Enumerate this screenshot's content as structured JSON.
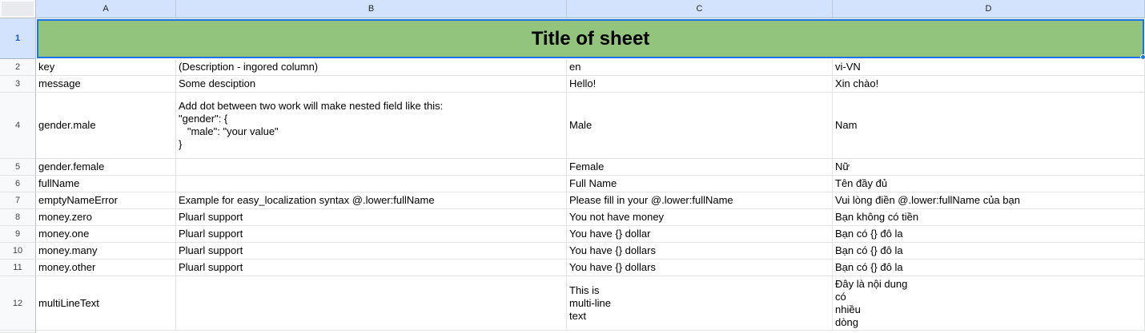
{
  "columns": [
    "A",
    "B",
    "C",
    "D"
  ],
  "title": "Title of sheet",
  "accent_color": "#1a73e8",
  "title_fill_color": "#93c47d",
  "rows": [
    {
      "num": "1"
    },
    {
      "num": "2",
      "cells": [
        "key",
        "(Description - ingored column)",
        "en",
        "vi-VN"
      ]
    },
    {
      "num": "3",
      "cells": [
        "message",
        "Some desciption",
        "Hello!",
        "Xin chào!"
      ]
    },
    {
      "num": "4",
      "cells": [
        "gender.male",
        "Add dot between two work will make nested field like this:\n\"gender\": {\n   \"male\": \"your value\"\n}",
        "Male",
        "Nam"
      ]
    },
    {
      "num": "5",
      "cells": [
        "gender.female",
        "",
        "Female",
        "Nữ"
      ]
    },
    {
      "num": "6",
      "cells": [
        "fullName",
        "",
        "Full Name",
        "Tên đầy đủ"
      ]
    },
    {
      "num": "7",
      "cells": [
        "emptyNameError",
        "Example for easy_localization syntax @.lower:fullName",
        "Please fill in your @.lower:fullName",
        "Vui lòng điền @.lower:fullName của bạn"
      ]
    },
    {
      "num": "8",
      "cells": [
        "money.zero",
        "Pluarl support",
        "You not have money",
        "Bạn không có tiền"
      ]
    },
    {
      "num": "9",
      "cells": [
        "money.one",
        "Pluarl support",
        "You have {} dollar",
        "Bạn có {} đô la"
      ]
    },
    {
      "num": "10",
      "cells": [
        "money.many",
        "Pluarl support",
        "You have {} dollars",
        "Bạn có {} đô la"
      ]
    },
    {
      "num": "11",
      "cells": [
        "money.other",
        "Pluarl support",
        "You have {} dollars",
        "Bạn có {} đô la"
      ]
    },
    {
      "num": "12",
      "cells": [
        "multiLineText",
        "",
        "This is\nmulti-line\ntext",
        "Đây là nội dung\ncó\nnhiều\ndòng"
      ]
    }
  ]
}
